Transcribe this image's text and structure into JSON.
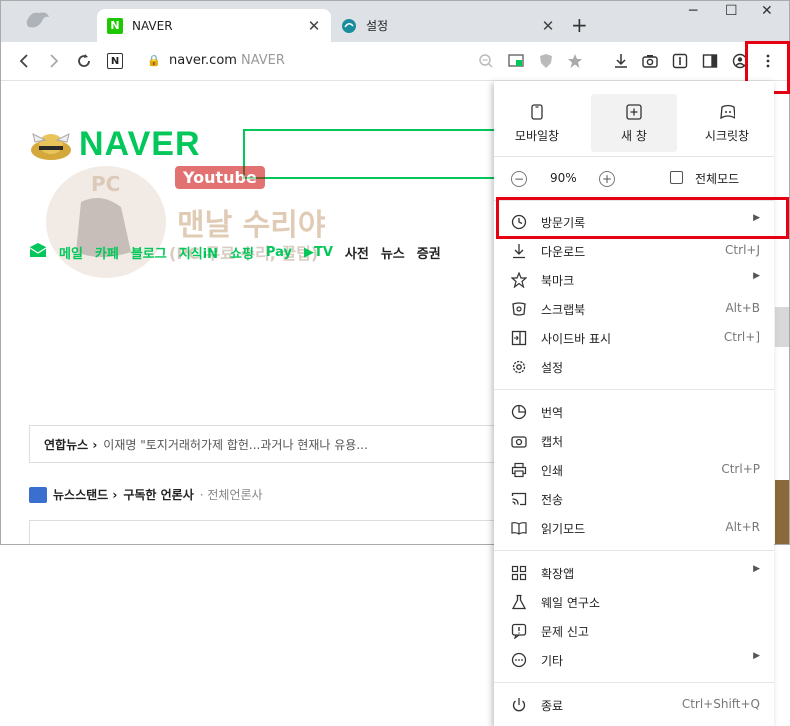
{
  "tabs": [
    {
      "label": "NAVER",
      "favicon": "N"
    },
    {
      "label": "설정"
    }
  ],
  "window_controls": {
    "minimize": "─",
    "maximize": "☐",
    "close": "✕"
  },
  "address": {
    "url": "naver.com",
    "title": "NAVER",
    "favicon": "N"
  },
  "page": {
    "logo": "NAVER",
    "nav": [
      "메일",
      "카페",
      "블로그",
      "지식iN",
      "쇼핑",
      "Pay",
      "▶TV",
      "사전",
      "뉴스",
      "증권"
    ],
    "ticker_source": "연합뉴스 ›",
    "ticker_text": "이재명 \"토지거래허가제 합헌...과거나 현재나 유용...",
    "newsstand": "뉴스스탠드 ›",
    "subscribed": "구독한 언론사",
    "all_press": "· 전체언론사",
    "watermark": {
      "youtube": "Youtube",
      "title": "맨날 수리야",
      "subtitle": "(PC 무료 수리, 꿀팁)",
      "pc": "PC"
    }
  },
  "menu": {
    "top_buttons": [
      {
        "label": "모바일창",
        "icon": "mobile-icon"
      },
      {
        "label": "새 창",
        "icon": "new-window-icon"
      },
      {
        "label": "시크릿창",
        "icon": "secret-icon"
      }
    ],
    "zoom": {
      "minus": "−",
      "value": "90%",
      "plus": "+",
      "fullscreen": "전체모드"
    },
    "items": [
      {
        "label": "방문기록",
        "shortcut": "",
        "arrow": true,
        "icon": "history-icon"
      },
      {
        "label": "다운로드",
        "shortcut": "Ctrl+J",
        "arrow": false,
        "icon": "download-icon"
      },
      {
        "label": "북마크",
        "shortcut": "",
        "arrow": true,
        "icon": "star-icon"
      },
      {
        "label": "스크랩북",
        "shortcut": "Alt+B",
        "arrow": false,
        "icon": "scrapbook-icon"
      },
      {
        "label": "사이드바 표시",
        "shortcut": "Ctrl+]",
        "arrow": false,
        "icon": "sidebar-icon"
      },
      {
        "label": "설정",
        "shortcut": "",
        "arrow": false,
        "icon": "gear-icon"
      },
      {
        "label": "번역",
        "shortcut": "",
        "arrow": false,
        "icon": "translate-icon"
      },
      {
        "label": "캡처",
        "shortcut": "",
        "arrow": false,
        "icon": "camera-icon"
      },
      {
        "label": "인쇄",
        "shortcut": "Ctrl+P",
        "arrow": false,
        "icon": "print-icon"
      },
      {
        "label": "전송",
        "shortcut": "",
        "arrow": false,
        "icon": "cast-icon"
      },
      {
        "label": "읽기모드",
        "shortcut": "Alt+R",
        "arrow": false,
        "icon": "reader-icon"
      },
      {
        "label": "확장앱",
        "shortcut": "",
        "arrow": true,
        "icon": "extensions-icon"
      },
      {
        "label": "웨일 연구소",
        "shortcut": "",
        "arrow": false,
        "icon": "flask-icon"
      },
      {
        "label": "문제 신고",
        "shortcut": "",
        "arrow": false,
        "icon": "report-icon"
      },
      {
        "label": "기타",
        "shortcut": "",
        "arrow": true,
        "icon": "more-icon"
      },
      {
        "label": "종료",
        "shortcut": "Ctrl+Shift+Q",
        "arrow": false,
        "icon": "power-icon"
      }
    ]
  },
  "colors": {
    "naver_green": "#03c75a",
    "highlight_red": "#e60012"
  }
}
